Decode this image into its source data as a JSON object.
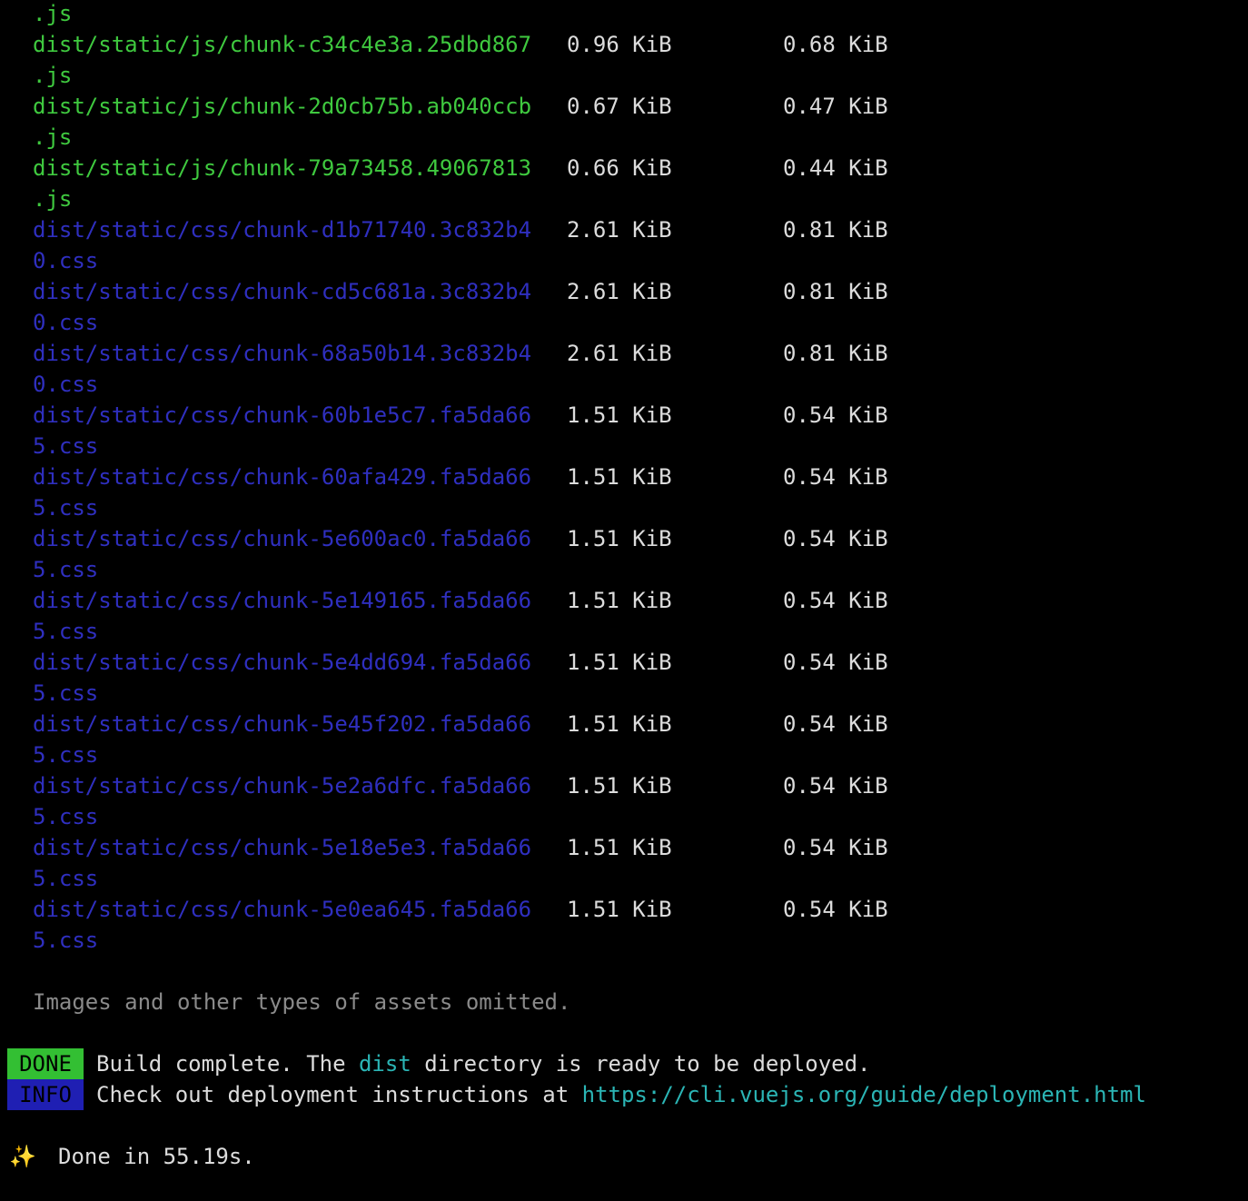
{
  "rows": [
    {
      "name_line1": "",
      "name_line2": ".js",
      "size": "",
      "gzipped": "",
      "kind": "js"
    },
    {
      "name_line1": "dist/static/js/chunk-c34c4e3a.25dbd867",
      "name_line2": ".js",
      "size": "0.96 KiB",
      "gzipped": "0.68 KiB",
      "kind": "js"
    },
    {
      "name_line1": "dist/static/js/chunk-2d0cb75b.ab040ccb",
      "name_line2": ".js",
      "size": "0.67 KiB",
      "gzipped": "0.47 KiB",
      "kind": "js"
    },
    {
      "name_line1": "dist/static/js/chunk-79a73458.49067813",
      "name_line2": ".js",
      "size": "0.66 KiB",
      "gzipped": "0.44 KiB",
      "kind": "js"
    },
    {
      "name_line1": "dist/static/css/chunk-d1b71740.3c832b4",
      "name_line2": "0.css",
      "size": "2.61 KiB",
      "gzipped": "0.81 KiB",
      "kind": "css"
    },
    {
      "name_line1": "dist/static/css/chunk-cd5c681a.3c832b4",
      "name_line2": "0.css",
      "size": "2.61 KiB",
      "gzipped": "0.81 KiB",
      "kind": "css"
    },
    {
      "name_line1": "dist/static/css/chunk-68a50b14.3c832b4",
      "name_line2": "0.css",
      "size": "2.61 KiB",
      "gzipped": "0.81 KiB",
      "kind": "css"
    },
    {
      "name_line1": "dist/static/css/chunk-60b1e5c7.fa5da66",
      "name_line2": "5.css",
      "size": "1.51 KiB",
      "gzipped": "0.54 KiB",
      "kind": "css"
    },
    {
      "name_line1": "dist/static/css/chunk-60afa429.fa5da66",
      "name_line2": "5.css",
      "size": "1.51 KiB",
      "gzipped": "0.54 KiB",
      "kind": "css"
    },
    {
      "name_line1": "dist/static/css/chunk-5e600ac0.fa5da66",
      "name_line2": "5.css",
      "size": "1.51 KiB",
      "gzipped": "0.54 KiB",
      "kind": "css"
    },
    {
      "name_line1": "dist/static/css/chunk-5e149165.fa5da66",
      "name_line2": "5.css",
      "size": "1.51 KiB",
      "gzipped": "0.54 KiB",
      "kind": "css"
    },
    {
      "name_line1": "dist/static/css/chunk-5e4dd694.fa5da66",
      "name_line2": "5.css",
      "size": "1.51 KiB",
      "gzipped": "0.54 KiB",
      "kind": "css"
    },
    {
      "name_line1": "dist/static/css/chunk-5e45f202.fa5da66",
      "name_line2": "5.css",
      "size": "1.51 KiB",
      "gzipped": "0.54 KiB",
      "kind": "css"
    },
    {
      "name_line1": "dist/static/css/chunk-5e2a6dfc.fa5da66",
      "name_line2": "5.css",
      "size": "1.51 KiB",
      "gzipped": "0.54 KiB",
      "kind": "css"
    },
    {
      "name_line1": "dist/static/css/chunk-5e18e5e3.fa5da66",
      "name_line2": "5.css",
      "size": "1.51 KiB",
      "gzipped": "0.54 KiB",
      "kind": "css"
    },
    {
      "name_line1": "dist/static/css/chunk-5e0ea645.fa5da66",
      "name_line2": "5.css",
      "size": "1.51 KiB",
      "gzipped": "0.54 KiB",
      "kind": "css"
    }
  ],
  "note": "Images and other types of assets omitted.",
  "done_badge": "DONE",
  "done_message_pre": "Build complete. The ",
  "done_message_highlight": "dist",
  "done_message_post": " directory is ready to be deployed.",
  "info_badge": "INFO",
  "info_message_pre": "Check out deployment instructions at ",
  "info_message_link": "https://cli.vuejs.org/guide/deployment.html",
  "sparkle_icon": "✨",
  "final_message": "Done in 55.19s.",
  "colors": {
    "background": "#000000",
    "js_file": "#3fc93f",
    "css_file": "#2f2fbf",
    "done_badge": "#33bf33",
    "info_badge": "#1f1fb3",
    "link": "#2bb5b5"
  }
}
